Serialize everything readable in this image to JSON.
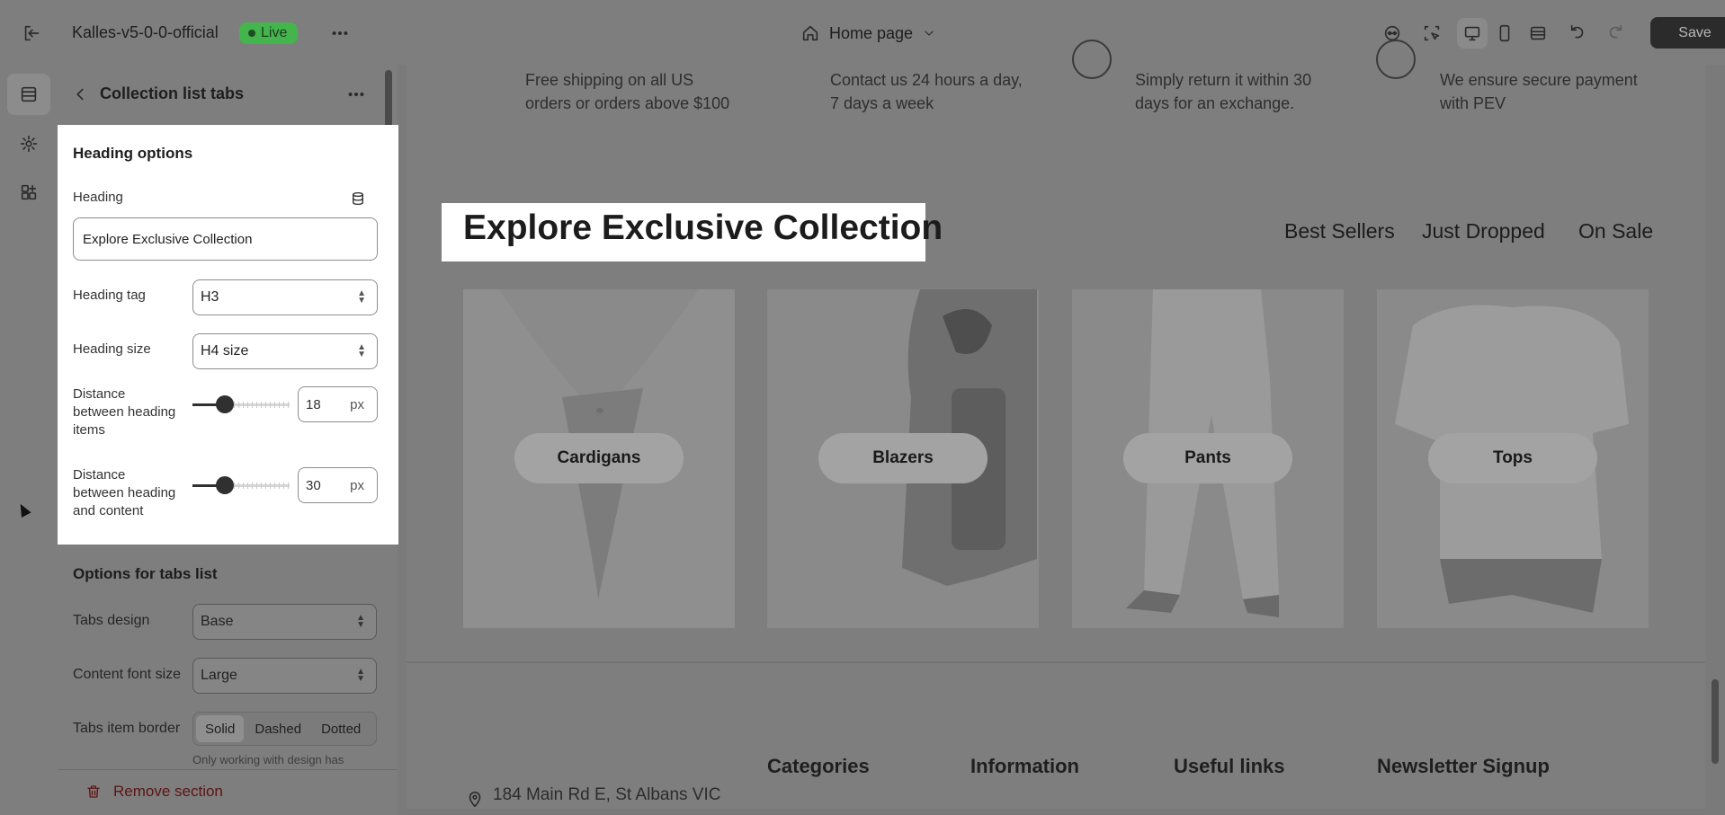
{
  "topbar": {
    "shop_name": "Kalles-v5-0-0-official",
    "status_badge": "Live",
    "page_selector": "Home page",
    "save_label": "Save"
  },
  "panel": {
    "title": "Collection list tabs",
    "heading_options": {
      "section_title": "Heading options",
      "heading_label": "Heading",
      "heading_value": "Explore Exclusive Collection",
      "heading_tag_label": "Heading tag",
      "heading_tag_value": "H3",
      "heading_size_label": "Heading size",
      "heading_size_value": "H4 size",
      "dist_items_label_1": "Distance",
      "dist_items_label_2": "between heading",
      "dist_items_label_3": "items",
      "dist_items_value": "18",
      "dist_content_label_1": "Distance",
      "dist_content_label_2": "between heading",
      "dist_content_label_3": "and content",
      "dist_content_value": "30",
      "unit": "px"
    },
    "tabs_options": {
      "section_title": "Options for tabs list",
      "tabs_design_label": "Tabs design",
      "tabs_design_value": "Base",
      "content_font_label": "Content font size",
      "content_font_value": "Large",
      "border_label": "Tabs item border",
      "border_options": [
        "Solid",
        "Dashed",
        "Dotted"
      ],
      "border_selected": "Solid",
      "border_note": "Only working with design has"
    },
    "remove_label": "Remove section"
  },
  "preview": {
    "features": [
      {
        "line1": "Free shipping on all US",
        "line2": "orders or orders above $100"
      },
      {
        "line1": "Contact us 24 hours a day,",
        "line2": "7 days a week"
      },
      {
        "line1": "Simply return it within 30",
        "line2": "days for an exchange."
      },
      {
        "line1": "We ensure secure payment",
        "line2": "with PEV"
      }
    ],
    "heading": "Explore Exclusive Collection",
    "tabs": [
      "Best Sellers",
      "Just Dropped",
      "On Sale"
    ],
    "collections": [
      "Cardigans",
      "Blazers",
      "Pants",
      "Tops"
    ],
    "footer_headings": [
      "Categories",
      "Information",
      "Useful links",
      "Newsletter Signup"
    ],
    "address": "184 Main Rd E, St Albans VIC"
  },
  "colors": {
    "live_badge": "#44b44c",
    "save_button": "#2b2b2b",
    "remove_text": "#5d1414"
  }
}
